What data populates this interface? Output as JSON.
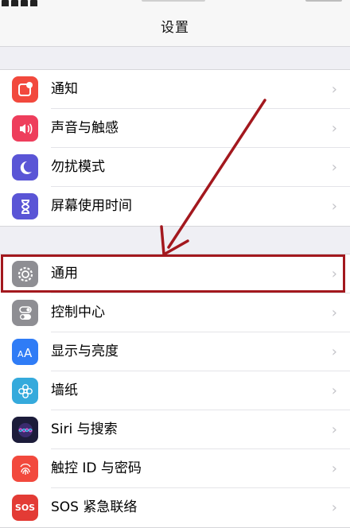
{
  "nav": {
    "title": "设置"
  },
  "group1": [
    {
      "id": "notifications",
      "label": "通知",
      "icon": "notifications-icon",
      "color": "#f2493d"
    },
    {
      "id": "sounds",
      "label": "声音与触感",
      "icon": "sound-icon",
      "color": "#ee3e5c"
    },
    {
      "id": "dnd",
      "label": "勿扰模式",
      "icon": "moon-icon",
      "color": "#5a55d6"
    },
    {
      "id": "screen-time",
      "label": "屏幕使用时间",
      "icon": "hourglass-icon",
      "color": "#5a55d6"
    }
  ],
  "group2": [
    {
      "id": "general",
      "label": "通用",
      "icon": "gear-icon",
      "color": "#8e8e93"
    },
    {
      "id": "control-center",
      "label": "控制中心",
      "icon": "toggles-icon",
      "color": "#8e8e93"
    },
    {
      "id": "display",
      "label": "显示与亮度",
      "icon": "text-size-icon",
      "color": "#2f7cf6"
    },
    {
      "id": "wallpaper",
      "label": "墙纸",
      "icon": "flower-icon",
      "color": "#35aadc"
    },
    {
      "id": "siri",
      "label": "Siri 与搜索",
      "icon": "siri-icon",
      "color": "#1c1c3a"
    },
    {
      "id": "touch-id",
      "label": "触控 ID 与密码",
      "icon": "fingerprint-icon",
      "color": "#f2493d"
    },
    {
      "id": "sos",
      "label": "SOS 紧急联络",
      "icon": "sos-icon",
      "color": "#e33b35",
      "icon_text": "SOS"
    }
  ],
  "chevron": "›",
  "annotation": {
    "color": "#a3181e",
    "target": "general"
  }
}
